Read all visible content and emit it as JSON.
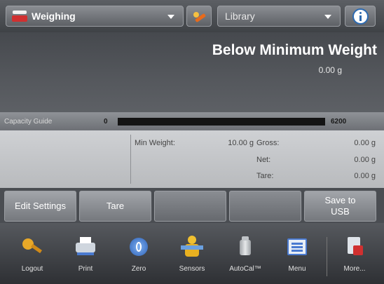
{
  "top_bar": {
    "app_dropdown": {
      "label": "Weighing",
      "icon": "scale-icon"
    },
    "tool_button": {
      "icon": "tool-icon"
    },
    "library_dropdown": {
      "label": "Library"
    },
    "info_button": {
      "icon": "info-icon"
    }
  },
  "display": {
    "status_message": "Below Minimum Weight",
    "reading": "0.00 g"
  },
  "capacity_guide": {
    "label": "Capacity Guide",
    "min": "0",
    "max": "6200",
    "fill_fraction": 0.0
  },
  "info_panel": {
    "min_weight_label": "Min Weight:",
    "min_weight_value": "10.00 g",
    "gross_label": "Gross:",
    "gross_value": "0.00 g",
    "net_label": "Net:",
    "net_value": "0.00 g",
    "tare_label": "Tare:",
    "tare_value": "0.00 g"
  },
  "softkeys": [
    {
      "label": "Edit Settings"
    },
    {
      "label": "Tare"
    },
    {
      "label": ""
    },
    {
      "label": ""
    },
    {
      "label": "Save to\nUSB"
    }
  ],
  "nav": [
    {
      "label": "Logout",
      "icon": "key-icon"
    },
    {
      "label": "Print",
      "icon": "printer-icon"
    },
    {
      "label": "Zero",
      "icon": "zero-icon"
    },
    {
      "label": "Sensors",
      "icon": "sensors-icon"
    },
    {
      "label": "AutoCal™",
      "icon": "autocal-icon"
    },
    {
      "label": "Menu",
      "icon": "menu-icon"
    },
    {
      "label": "More...",
      "icon": "more-icon"
    }
  ],
  "colors": {
    "capacity_bar": "#141414",
    "brand_red": "#d03030",
    "info_blue": "#2d6ab0"
  }
}
